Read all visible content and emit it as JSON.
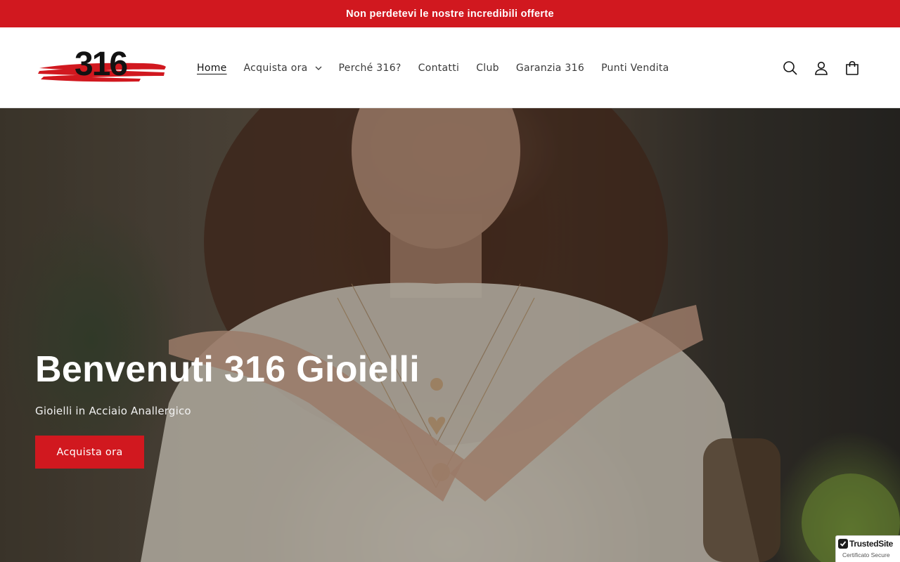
{
  "announcement": {
    "text": "Non perdetevi le nostre incredibili offerte"
  },
  "header": {
    "logo_text": "316",
    "nav": [
      {
        "label": "Home",
        "active": true
      },
      {
        "label": "Acquista ora",
        "has_dropdown": true
      },
      {
        "label": "Perché 316?"
      },
      {
        "label": "Contatti"
      },
      {
        "label": "Club"
      },
      {
        "label": "Garanzia 316"
      },
      {
        "label": "Punti Vendita"
      }
    ],
    "icons": [
      "search-icon",
      "account-icon",
      "cart-icon"
    ]
  },
  "hero": {
    "title": "Benvenuti 316 Gioielli",
    "subtitle": "Gioielli in Acciaio Anallergico",
    "cta_label": "Acquista ora"
  },
  "badge": {
    "name": "TrustedSite",
    "subtext": "Certificato Secure"
  },
  "colors": {
    "brand_red": "#d1181f",
    "text_dark": "#121212",
    "white": "#ffffff"
  }
}
